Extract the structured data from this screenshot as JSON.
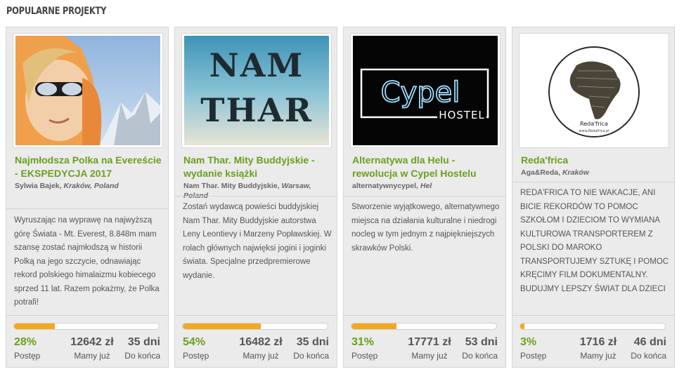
{
  "section": {
    "title": "Popularne projekty"
  },
  "colors": {
    "accent": "#6aa01c",
    "progress": "#f5a81d"
  },
  "labels": {
    "progress": "Postęp",
    "raised": "Mamy już",
    "remaining": "Do końca"
  },
  "projects": [
    {
      "title": "Najmłodsza Polka na Evereście - EKSPEDYCJA 2017",
      "author": "Sylwia Bajek",
      "location": "Kraków, Poland",
      "description": "Wyruszając na wyprawę na najwyższą górę Świata - Mt. Everest, 8.848m mam szansę zostać najmłodszą w historii Polką na jego szczycie, odnawiając rekord polskiego himalaizmu kobiecego sprzed 11 lat. Razem pokażmy, że Polka potrafi!",
      "progress_percent": 28,
      "percent_label": "28%",
      "raised": "12642 zł",
      "days_left": "35 dni"
    },
    {
      "title": "Nam Thar. Mity Buddyjskie - wydanie książki",
      "author": "Nam Thar. Mity Buddyjskie",
      "location": "Warsaw, Poland",
      "image_text": [
        "NAM",
        "THAR"
      ],
      "description": "Zostań wydawcą powieści buddyjskiej Nam Thar. Mity Buddyjskie autorstwa Leny Leontievy i Marzeny Popławskiej. W rolach głównych najwięksi jogini i joginki świata. Specjalne przedpremierowe wydanie.",
      "progress_percent": 54,
      "percent_label": "54%",
      "raised": "16482 zł",
      "days_left": "35 dni"
    },
    {
      "title": "Alternatywa dla Helu - rewolucja w Cypel Hostelu",
      "author": "alternatywnycypel",
      "location": "Hel",
      "image_text": [
        "Cypel",
        "HOSTEL"
      ],
      "description": "Stworzenie wyjątkowego, alternatywnego miejsca na działania kulturalne i niedrogi nocleg w tym jednym z najpiękniejszych skrawków Polski.",
      "progress_percent": 31,
      "percent_label": "31%",
      "raised": "17771 zł",
      "days_left": "53 dni"
    },
    {
      "title": "Reda'frica",
      "author": "Aga&Reda",
      "location": "Kraków",
      "image_text": [
        "Reda'frica",
        "www.Redafrica.pl"
      ],
      "description": "Reda'frica to nie wakacje, ani bicie rekordów to pomoc szkołom i dzieciom to wymiana kulturowa transporterem z Polski do Maroko transportujemy sztukę i pomoc kręcimy film dokumentalny. Budujmy lepszy świat dla dzieci",
      "progress_percent": 3,
      "percent_label": "3%",
      "raised": "1716 zł",
      "days_left": "46 dni"
    }
  ]
}
